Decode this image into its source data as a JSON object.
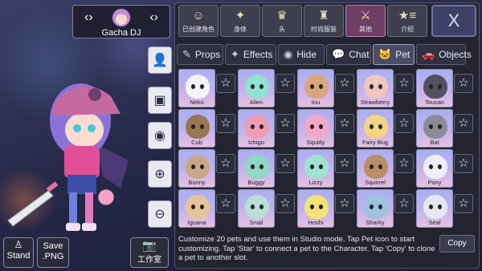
{
  "character": {
    "name": "Gacha DJ"
  },
  "left_buttons": {
    "stand": "Stand",
    "save_png_line1": "Save",
    "save_png_line2": ".PNG",
    "studio": "工作室"
  },
  "categories": [
    {
      "label": "已创建角色",
      "icon": "person-icon",
      "glyph": "☺"
    },
    {
      "label": "身体",
      "icon": "jacket-icon",
      "glyph": "✦"
    },
    {
      "label": "头",
      "icon": "hair-icon",
      "glyph": "♛"
    },
    {
      "label": "时尚服装",
      "icon": "shirt-icon",
      "glyph": "♜"
    },
    {
      "label": "其他",
      "icon": "sword-cat-icon",
      "glyph": "⚔"
    },
    {
      "label": "介绍",
      "icon": "star-list-icon",
      "glyph": "★≡"
    }
  ],
  "close_glyph": "X",
  "tabs": [
    {
      "label": "Props",
      "glyph": "✎"
    },
    {
      "label": "Effects",
      "glyph": "✦"
    },
    {
      "label": "Hide",
      "glyph": "◉"
    },
    {
      "label": "Chat",
      "glyph": "💬"
    },
    {
      "label": "Pet",
      "glyph": "🐱"
    },
    {
      "label": "Objects",
      "glyph": "🚗"
    }
  ],
  "star_glyph": "☆",
  "pets": [
    {
      "name": "Neko",
      "color": "#f4f4f8"
    },
    {
      "name": "Alien",
      "color": "#8fe3d3"
    },
    {
      "name": "Inu",
      "color": "#d9a77b"
    },
    {
      "name": "Strawberry",
      "color": "#f0c5c0"
    },
    {
      "name": "Toucan",
      "color": "#555060"
    },
    {
      "name": "Cub",
      "color": "#9b7654"
    },
    {
      "name": "Ichigo",
      "color": "#f19bb5"
    },
    {
      "name": "Squidy",
      "color": "#f3a7c9"
    },
    {
      "name": "Fairy Bug",
      "color": "#f3d384"
    },
    {
      "name": "Bat",
      "color": "#8a8b97"
    },
    {
      "name": "Bunny",
      "color": "#c9a688"
    },
    {
      "name": "Buggy",
      "color": "#8ed7c2"
    },
    {
      "name": "Lizzy",
      "color": "#9fe2cf"
    },
    {
      "name": "Squirrel",
      "color": "#b88d68"
    },
    {
      "name": "Pony",
      "color": "#eeeef6"
    },
    {
      "name": "Iguana",
      "color": "#e6c49a"
    },
    {
      "name": "Snail",
      "color": "#b9ded6"
    },
    {
      "name": "Hoshi",
      "color": "#f3e179"
    },
    {
      "name": "Sharky",
      "color": "#9dc3df"
    },
    {
      "name": "Seal",
      "color": "#e5e7ef"
    }
  ],
  "footer": {
    "text": "Customize 20 pets and use them in Studio mode. Tap Pet icon to start customizing. Tap 'Star' to connect a pet to the Character. Tap 'Copy' to clone a pet to another slot.",
    "copy": "Copy"
  }
}
